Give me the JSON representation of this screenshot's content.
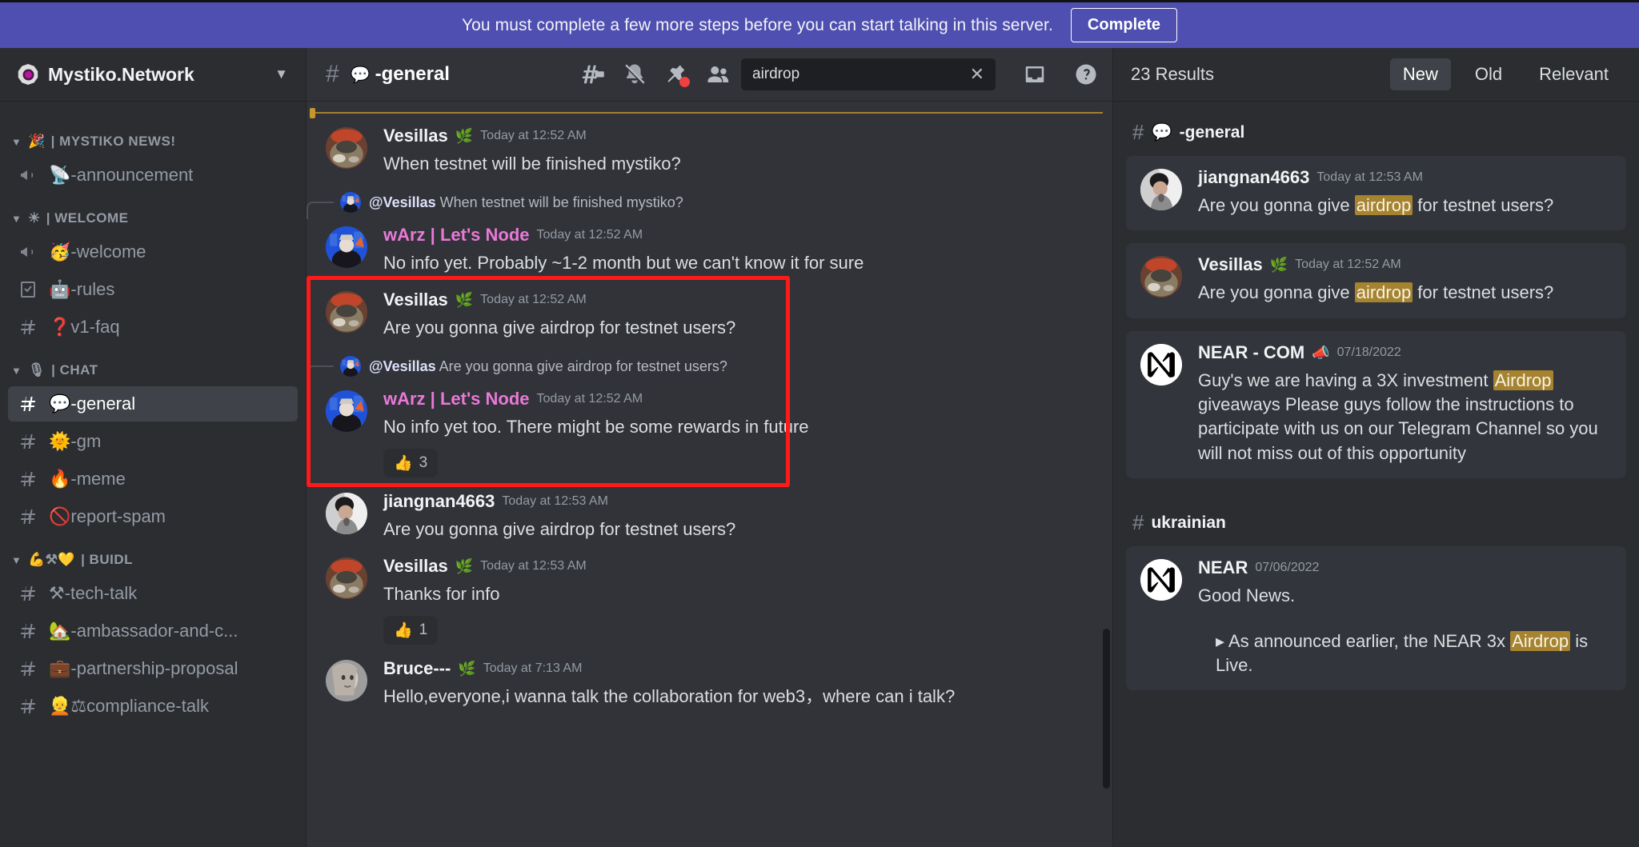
{
  "banner": {
    "text": "You must complete a few more steps before you can start talking in this server.",
    "button": "Complete",
    "color": "#4e4fb0"
  },
  "sidebar": {
    "server_name": "Mystiko.Network",
    "dropdown_icon": "chevron-down-icon",
    "categories": [
      {
        "label": "| MYSTIKO NEWS!",
        "emoji": "🎉",
        "channels": [
          {
            "icon": "announcement-icon",
            "emoji": "📡",
            "label": "-announcement",
            "active": false
          }
        ]
      },
      {
        "label": "| WELCOME",
        "emoji": "☀",
        "channels": [
          {
            "icon": "announcement-icon",
            "emoji": "🥳",
            "label": "-welcome",
            "active": false
          },
          {
            "icon": "rules-icon",
            "emoji": "🤖",
            "label": "-rules",
            "active": false
          },
          {
            "icon": "hash-icon",
            "emoji": "❓",
            "label": "v1-faq",
            "active": false
          }
        ]
      },
      {
        "label": "| CHAT",
        "emoji": "🎙",
        "channels": [
          {
            "icon": "hash-icon",
            "emoji": "💬",
            "label": "-general",
            "active": true
          },
          {
            "icon": "hash-icon",
            "emoji": "🌞",
            "label": "-gm",
            "active": false
          },
          {
            "icon": "hash-icon",
            "emoji": "🔥",
            "label": "-meme",
            "active": false
          },
          {
            "icon": "hash-icon",
            "emoji": "🚫",
            "label": "report-spam",
            "active": false
          }
        ]
      },
      {
        "label": "| BUIDL",
        "emoji": "💪⚒💛",
        "channels": [
          {
            "icon": "hash-icon",
            "emoji": "⚒",
            "label": "-tech-talk",
            "active": false
          },
          {
            "icon": "hash-icon",
            "emoji": "🏡",
            "label": "-ambassador-and-c...",
            "active": false
          },
          {
            "icon": "hash-icon",
            "emoji": "💼",
            "label": "-partnership-proposal",
            "active": false
          },
          {
            "icon": "hash-icon",
            "emoji": "👱",
            "label": "⚖compliance-talk",
            "active": false
          }
        ]
      }
    ]
  },
  "channel_header": {
    "hash_icon": "hash-icon",
    "emoji": "💬",
    "title": "-general",
    "icons": [
      {
        "name": "threads-icon"
      },
      {
        "name": "bell-muted-icon"
      },
      {
        "name": "pinned-messages-icon",
        "badge": true
      },
      {
        "name": "members-icon"
      }
    ],
    "search": {
      "value": "airdrop",
      "placeholder": "Search",
      "clear_icon": "close-icon"
    },
    "inbox_icon": "inbox-icon",
    "help_icon": "help-icon"
  },
  "messages": [
    {
      "author": "Vesillas",
      "badge": "🌿",
      "timestamp": "Today at 12:52 AM",
      "text": "When testnet will be finished mystiko?",
      "avatar": "avatar-vesillas",
      "author_color": "#f2f3f5"
    },
    {
      "reply_to_author": "@Vesillas",
      "reply_to_text": "When testnet will be finished mystiko?",
      "author": "wArz | Let's Node",
      "author_color": "#e979d8",
      "timestamp": "Today at 12:52 AM",
      "text": "No info yet. Probably ~1-2 month but we can't know it for sure",
      "avatar": "avatar-warz"
    },
    {
      "author": "Vesillas",
      "badge": "🌿",
      "timestamp": "Today at 12:52 AM",
      "text": "Are you gonna give airdrop for testnet users?",
      "avatar": "avatar-vesillas",
      "highlighted": true
    },
    {
      "reply_to_author": "@Vesillas",
      "reply_to_text": "Are you gonna give airdrop for testnet users?",
      "author": "wArz | Let's Node",
      "author_color": "#e979d8",
      "timestamp": "Today at 12:52 AM",
      "text": "No info yet too. There might be some rewards in future",
      "avatar": "avatar-warz",
      "reaction_emoji": "👍",
      "reaction_count": "3",
      "highlighted": true
    },
    {
      "author": "jiangnan4663",
      "timestamp": "Today at 12:53 AM",
      "text": "Are you gonna give airdrop for testnet users?",
      "avatar": "avatar-jiangnan"
    },
    {
      "author": "Vesillas",
      "badge": "🌿",
      "timestamp": "Today at 12:53 AM",
      "text": "Thanks for info",
      "avatar": "avatar-vesillas",
      "reaction_emoji": "👍",
      "reaction_count": "1"
    },
    {
      "author": "Bruce---",
      "badge": "🌿",
      "timestamp": "Today at 7:13 AM",
      "text": "Hello,everyone,i wanna talk the collaboration for web3，where can i talk?",
      "avatar": "avatar-bruce"
    }
  ],
  "search_panel": {
    "result_count": "23 Results",
    "sort_tabs": [
      {
        "label": "New",
        "active": true
      },
      {
        "label": "Old",
        "active": false
      },
      {
        "label": "Relevant",
        "active": false
      }
    ],
    "groups": [
      {
        "channel": "-general",
        "channel_emoji": "💬",
        "results": [
          {
            "author": "jiangnan4663",
            "timestamp": "Today at 12:53 AM",
            "avatar": "avatar-jiangnan",
            "parts": [
              {
                "t": "Are you gonna give ",
                "hl": false
              },
              {
                "t": "airdrop",
                "hl": true
              },
              {
                "t": " for testnet users?",
                "hl": false
              }
            ]
          },
          {
            "author": "Vesillas",
            "badge": "🌿",
            "timestamp": "Today at 12:52 AM",
            "avatar": "avatar-vesillas",
            "parts": [
              {
                "t": "Are you gonna give ",
                "hl": false
              },
              {
                "t": "airdrop",
                "hl": true
              },
              {
                "t": " for testnet users?",
                "hl": false
              }
            ]
          },
          {
            "author": "NEAR - COM",
            "badge": "📣",
            "timestamp": "07/18/2022",
            "avatar": "avatar-near",
            "parts": [
              {
                "t": "Guy's we are having a 3X investment ",
                "hl": false
              },
              {
                "t": "Airdrop",
                "hl": true
              },
              {
                "t": " giveaways Please guys follow the instructions to participate with us on our Telegram Channel so you will not miss out of this opportunity",
                "hl": false
              }
            ]
          }
        ]
      },
      {
        "channel": "ukrainian",
        "channel_emoji": "",
        "results": [
          {
            "author": "NEAR",
            "timestamp": "07/06/2022",
            "avatar": "avatar-near",
            "parts": [
              {
                "t": "Good News.",
                "hl": false
              }
            ],
            "quote_parts": [
              {
                "t": "▸ As announced earlier, the NEAR 3x ",
                "hl": false
              },
              {
                "t": "Airdrop",
                "hl": true
              },
              {
                "t": " is Live.",
                "hl": false
              }
            ]
          }
        ]
      }
    ]
  },
  "highlight_box_color": "#ff1a1a"
}
